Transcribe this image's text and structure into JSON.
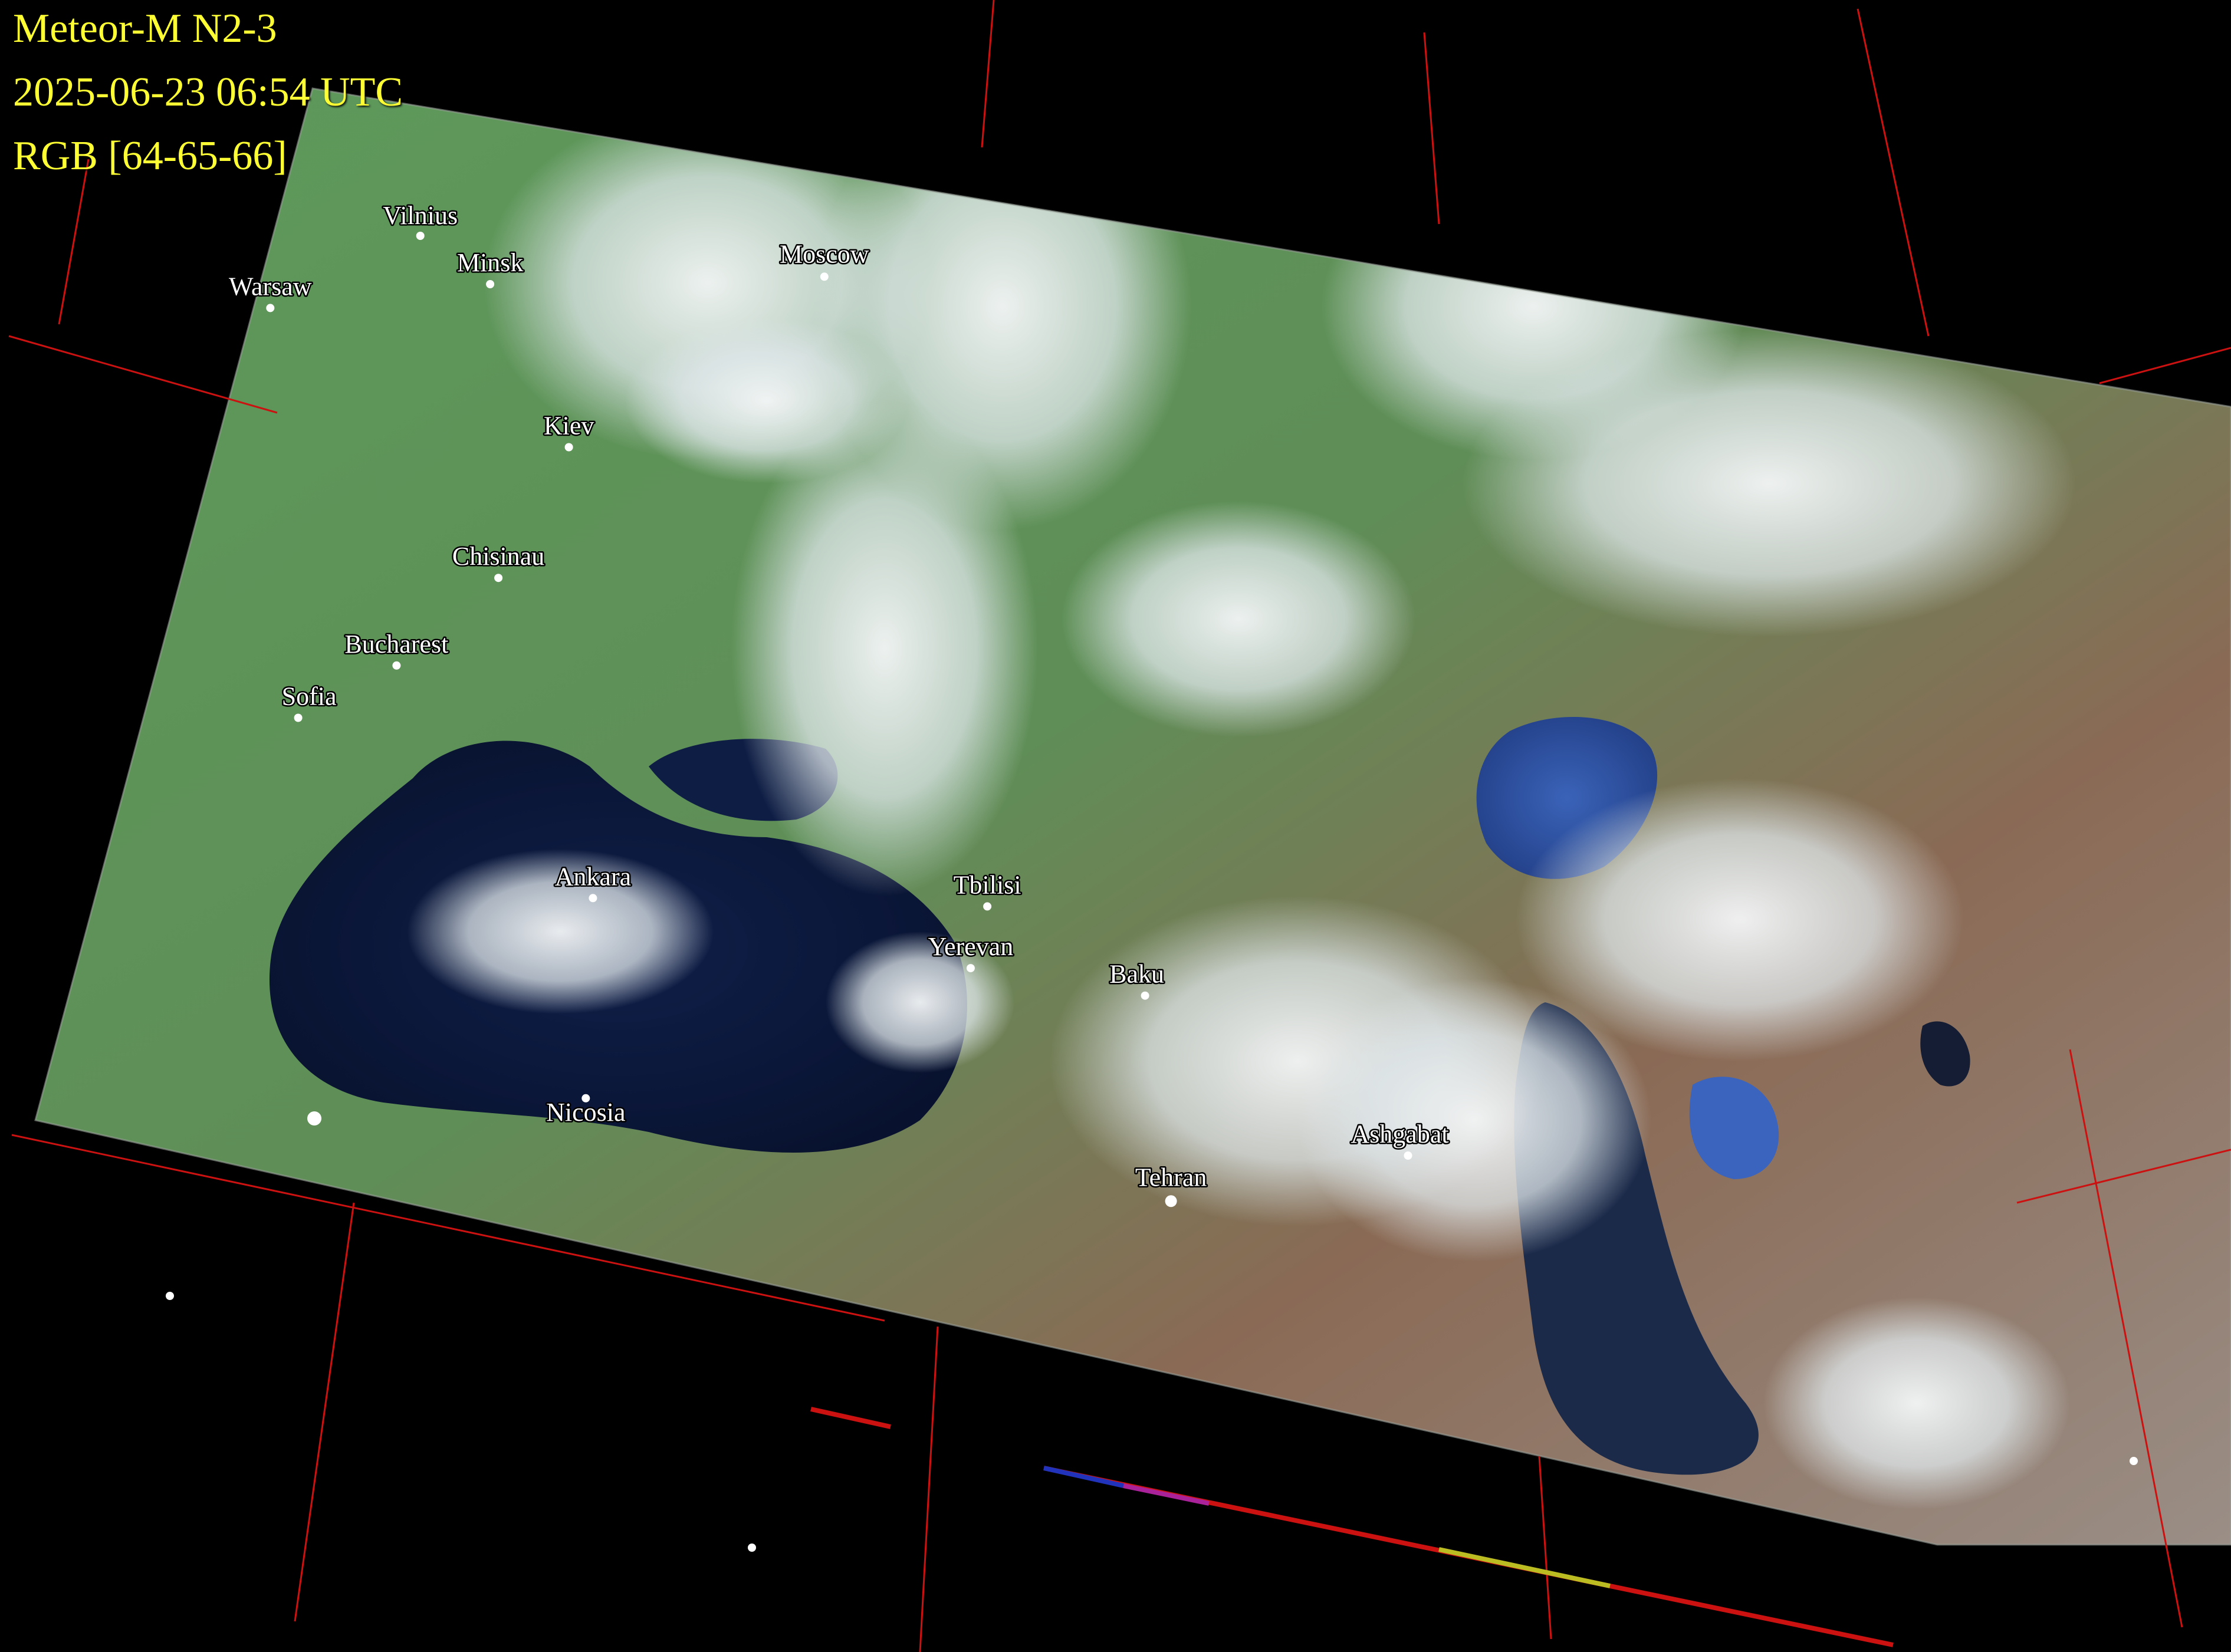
{
  "header": {
    "satellite": "Meteor-M N2-3",
    "timestamp": "2025-06-23 06:54 UTC",
    "composite": "RGB [64-65-66]"
  },
  "cities": [
    {
      "id": "vilnius",
      "name": "Vilnius",
      "lon": 25.28,
      "lat": 54.69
    },
    {
      "id": "moscow",
      "name": "Moscow",
      "lon": 37.62,
      "lat": 55.76
    },
    {
      "id": "minsk",
      "name": "Minsk",
      "lon": 27.56,
      "lat": 53.9
    },
    {
      "id": "warsaw",
      "name": "Warsaw",
      "lon": 21.01,
      "lat": 52.23
    },
    {
      "id": "kiev",
      "name": "Kiev",
      "lon": 30.52,
      "lat": 50.45
    },
    {
      "id": "chisinau",
      "name": "Chisinau",
      "lon": 28.86,
      "lat": 47.01
    },
    {
      "id": "bucharest",
      "name": "Bucharest",
      "lon": 26.1,
      "lat": 44.43
    },
    {
      "id": "sofia",
      "name": "Sofia",
      "lon": 23.32,
      "lat": 42.7
    },
    {
      "id": "ankara",
      "name": "Ankara",
      "lon": 32.86,
      "lat": 39.93
    },
    {
      "id": "tbilisi",
      "name": "Tbilisi",
      "lon": 44.79,
      "lat": 41.72
    },
    {
      "id": "yerevan",
      "name": "Yerevan",
      "lon": 44.51,
      "lat": 40.18
    },
    {
      "id": "baku",
      "name": "Baku",
      "lon": 49.87,
      "lat": 40.41
    },
    {
      "id": "ashgabat",
      "name": "Ashgabat",
      "lon": 58.38,
      "lat": 37.96
    },
    {
      "id": "tehran",
      "name": "Tehran",
      "lon": 51.39,
      "lat": 35.69
    },
    {
      "id": "nicosia",
      "name": "Nicosia",
      "lon": 33.36,
      "lat": 35.17
    }
  ],
  "colors": {
    "header_text": "#ffff33",
    "city_text": "#ffffff",
    "graticule": "#cc1111",
    "water": "#0b1838",
    "land": "#4f8a4c",
    "cloud": "#e9eef0"
  }
}
